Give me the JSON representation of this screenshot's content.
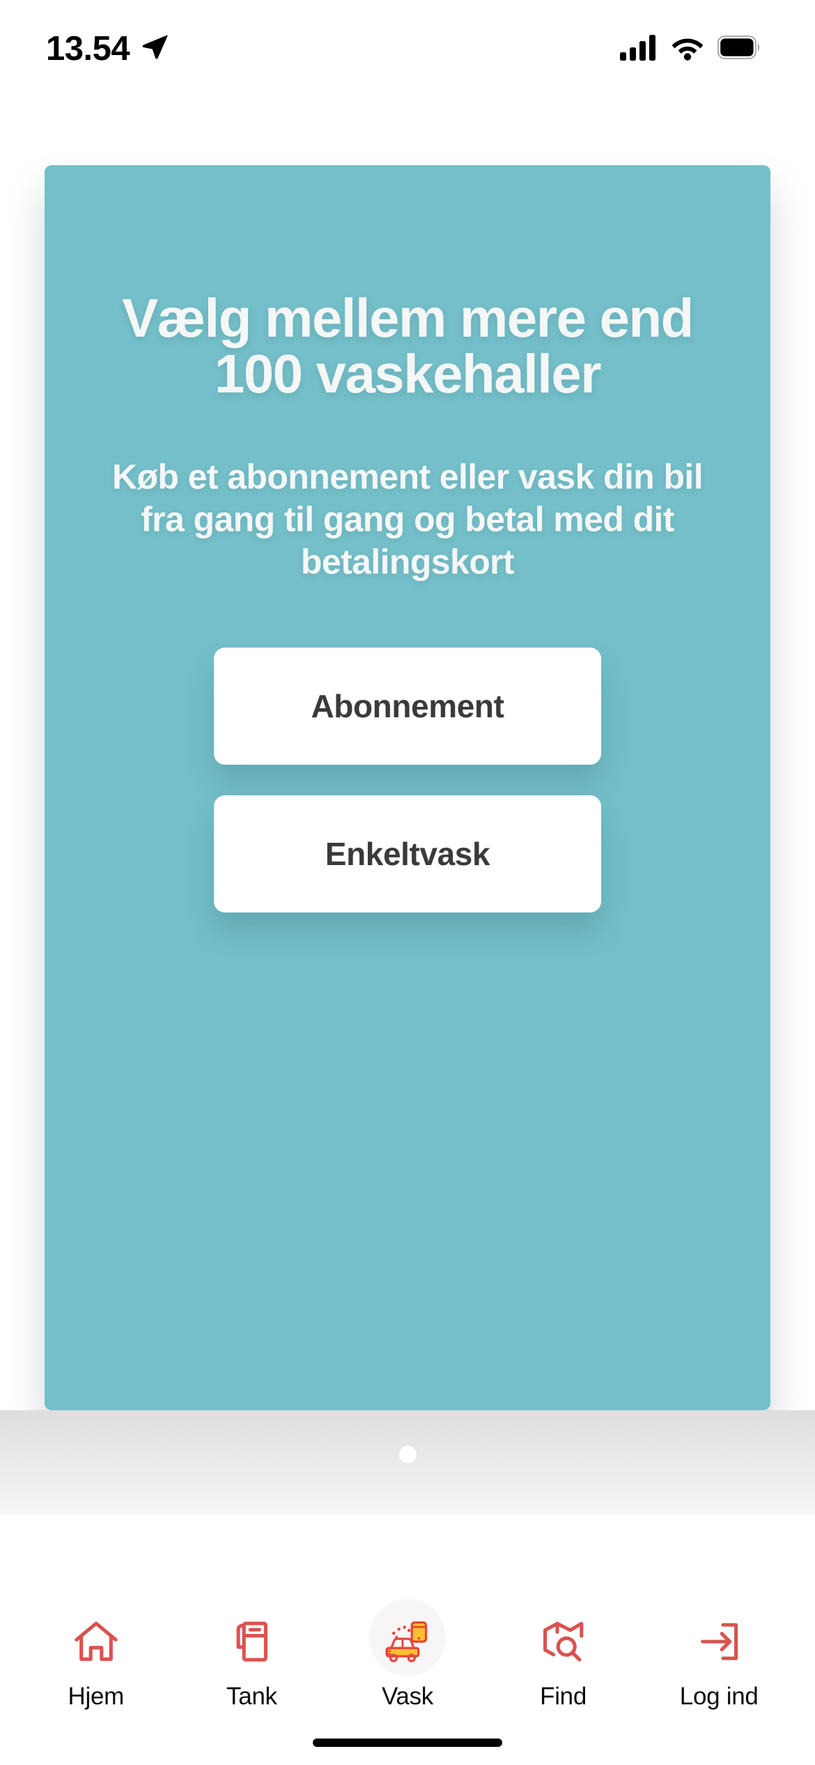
{
  "status_bar": {
    "time": "13.54",
    "location_icon": "location-arrow-icon",
    "cellular_icon": "cellular-bars-icon",
    "wifi_icon": "wifi-icon",
    "battery_icon": "battery-full-icon"
  },
  "card": {
    "background_color": "#74bfc9",
    "heading": "Vælg mellem mere end 100 vaskehaller",
    "body": "Køb et abonnement eller vask din bil fra gang til gang og betal med dit betalingskort",
    "buttons": [
      {
        "label": "Abonnement",
        "name": "abonnement-button"
      },
      {
        "label": "Enkeltvask",
        "name": "enkeltvask-button"
      }
    ]
  },
  "pagination": {
    "total": 1,
    "active_index": 0
  },
  "tabbar": {
    "accent_color": "#d9534f",
    "active_index": 2,
    "items": [
      {
        "label": "Hjem",
        "icon": "home-icon",
        "active": false
      },
      {
        "label": "Tank",
        "icon": "fuel-pump-icon",
        "active": false
      },
      {
        "label": "Vask",
        "icon": "car-wash-icon",
        "active": true
      },
      {
        "label": "Find",
        "icon": "map-search-icon",
        "active": false
      },
      {
        "label": "Log ind",
        "icon": "login-icon",
        "active": false
      }
    ]
  }
}
